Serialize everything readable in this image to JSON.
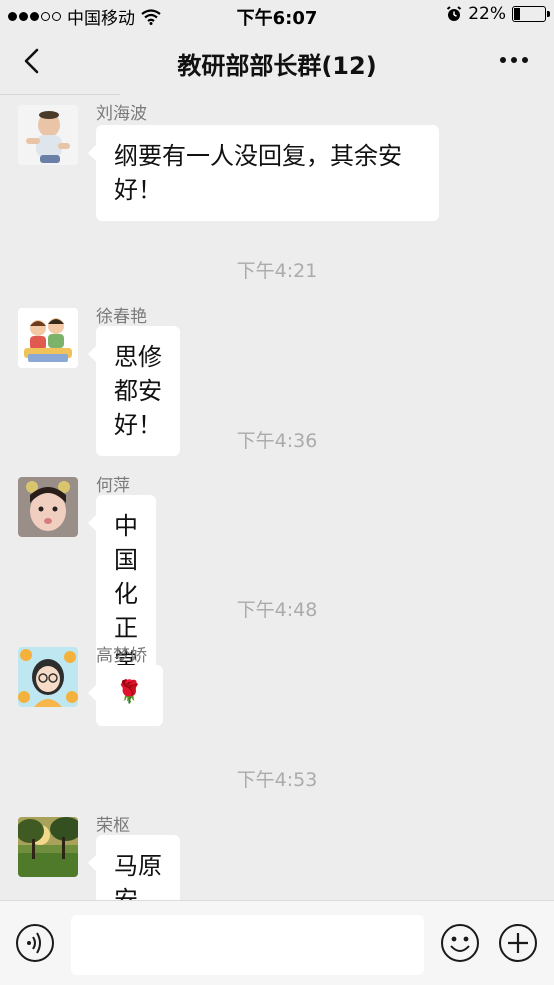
{
  "status_bar": {
    "carrier": "中国移动",
    "time": "下午6:07",
    "battery_percent": "22%",
    "battery_level": 0.22
  },
  "nav": {
    "title": "教研部部长群(12)"
  },
  "messages": [
    {
      "sender": "刘海波",
      "text": "纲要有一人没回复，其余安好！",
      "avatar_icon": "baby-avatar"
    },
    {
      "sender": "徐春艳",
      "text": "思修都安好！",
      "avatar_icon": "cartoon-family-avatar"
    },
    {
      "sender": "何萍",
      "text": "中国化正常",
      "avatar_icon": "child-avatar"
    },
    {
      "sender": "高梦娇",
      "text": "🌹",
      "avatar_icon": "cartoon-girl-avatar"
    },
    {
      "sender": "荣枢",
      "text": "马原安好，全员回复",
      "avatar_icon": "park-avatar"
    }
  ],
  "timestamps": [
    "下午4:21",
    "下午4:36",
    "下午4:48",
    "下午4:53"
  ],
  "input": {
    "placeholder": ""
  },
  "colors": {
    "background": "#ededed",
    "bubble": "#ffffff",
    "timestamp": "#ababab"
  }
}
